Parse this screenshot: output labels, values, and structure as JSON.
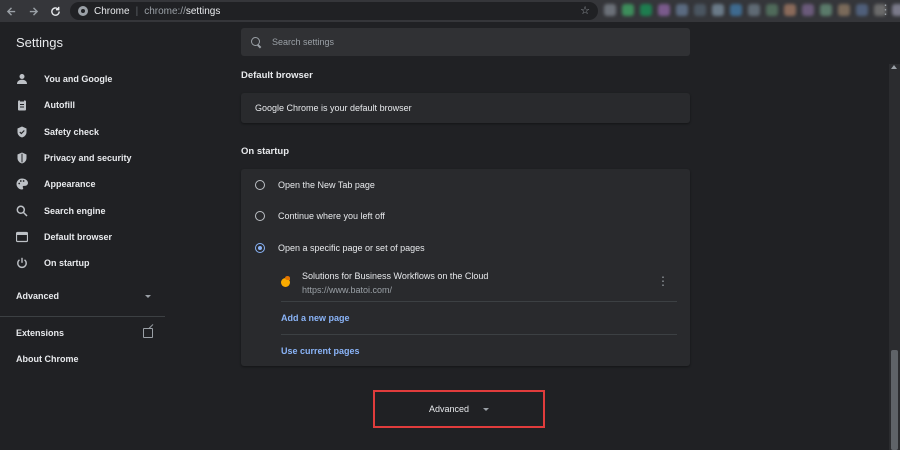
{
  "browser": {
    "tab_site": "Chrome",
    "url_scheme": "chrome://",
    "url_path": "settings",
    "icons": {
      "back": "arrow-left-icon",
      "forward": "arrow-right-icon",
      "reload": "reload-icon",
      "bookmark": "star-icon",
      "menu": "vertical-dots-icon"
    },
    "extension_colors": [
      "#6b7078",
      "#3d8d5b",
      "#1e7d4f",
      "#7a5a8c",
      "#5a6a80",
      "#4a5560",
      "#6a7a88",
      "#3e6a8f",
      "#5f6a74",
      "#4f6a5a",
      "#8a6a5a",
      "#6a5a7a",
      "#5a7a6a",
      "#7a6a5a",
      "#4f5f7a",
      "#6a6a6a",
      "#7a7a8a",
      "#5a6a5a",
      "#808890"
    ]
  },
  "header": {
    "title": "Settings",
    "search_placeholder": "Search settings"
  },
  "sidebar": {
    "items": [
      {
        "label": "You and Google",
        "icon": "person-icon"
      },
      {
        "label": "Autofill",
        "icon": "clipboard-icon"
      },
      {
        "label": "Safety check",
        "icon": "shield-check-icon"
      },
      {
        "label": "Privacy and security",
        "icon": "shield-icon"
      },
      {
        "label": "Appearance",
        "icon": "palette-icon"
      },
      {
        "label": "Search engine",
        "icon": "search-icon"
      },
      {
        "label": "Default browser",
        "icon": "browser-window-icon"
      },
      {
        "label": "On startup",
        "icon": "power-icon"
      }
    ],
    "advanced_label": "Advanced",
    "extensions_label": "Extensions",
    "about_label": "About Chrome"
  },
  "main": {
    "default_browser": {
      "title": "Default browser",
      "status": "Google Chrome is your default browser"
    },
    "on_startup": {
      "title": "On startup",
      "options": [
        {
          "label": "Open the New Tab page",
          "checked": false
        },
        {
          "label": "Continue where you left off",
          "checked": false
        },
        {
          "label": "Open a specific page or set of pages",
          "checked": true
        }
      ],
      "pages": [
        {
          "title": "Solutions for Business Workflows on the Cloud",
          "url": "https://www.batoi.com/"
        }
      ],
      "add_page_label": "Add a new page",
      "use_current_label": "Use current pages"
    },
    "advanced_button_label": "Advanced"
  },
  "colors": {
    "accent": "#8ab4f8",
    "highlight_box": "#e03c3c",
    "background": "#202124",
    "card": "#292a2d"
  }
}
